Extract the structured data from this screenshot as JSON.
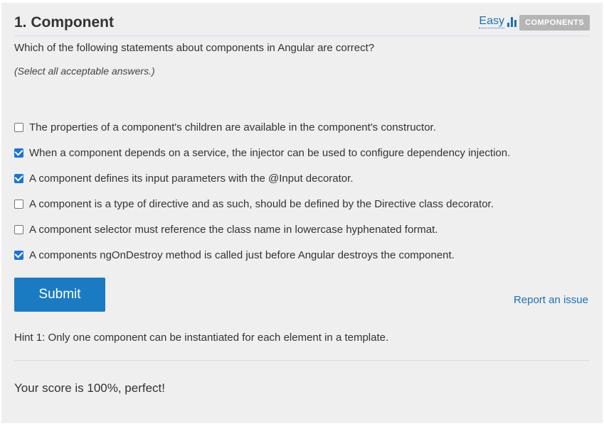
{
  "header": {
    "title": "1. Component",
    "difficulty": "Easy",
    "difficulty_icon": "bar-chart-icon",
    "tag": "COMPONENTS"
  },
  "question": "Which of the following statements about components in Angular are correct?",
  "instruction": "(Select all acceptable answers.)",
  "options": [
    {
      "label": "The properties of a component's children are available in the component's constructor.",
      "checked": false
    },
    {
      "label": "When a component depends on a service, the injector can be used to configure  dependency injection.",
      "checked": true
    },
    {
      "label": "A component defines its input parameters with the @Input decorator.",
      "checked": true
    },
    {
      "label": "A component is a type of directive and as such, should be defined by the Directive class decorator.",
      "checked": false
    },
    {
      "label": "A component selector must reference the class name in lowercase hyphenated format.",
      "checked": false
    },
    {
      "label": "A components ngOnDestroy method is called just before Angular destroys the component.",
      "checked": true
    }
  ],
  "submit_label": "Submit",
  "report_label": "Report an issue",
  "hint": "Hint 1: Only one component can be instantiated for each element in a template.",
  "score": "Your score is 100%, perfect!",
  "colors": {
    "accent": "#1a7bc2",
    "link": "#1a73b5",
    "checkbox": "#1a73d9",
    "tag_bg": "#b5b5b5"
  }
}
